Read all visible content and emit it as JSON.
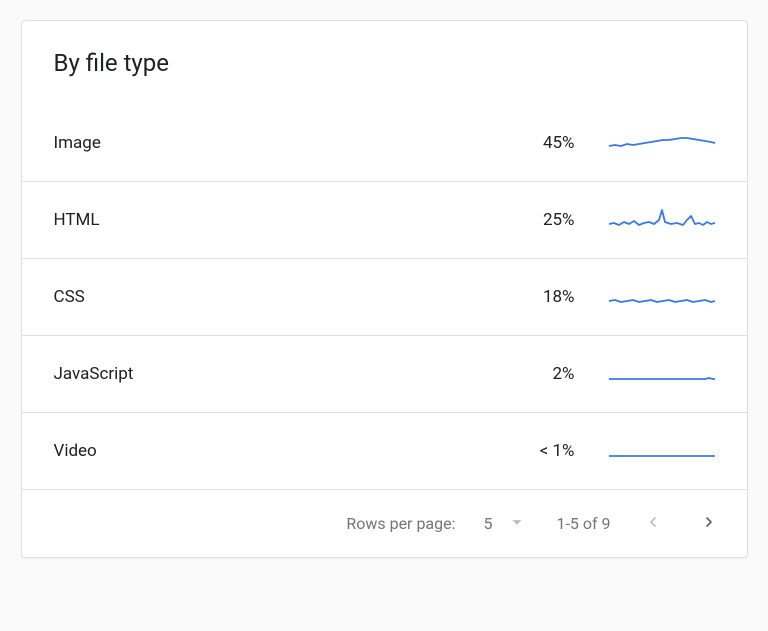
{
  "card": {
    "title": "By file type",
    "rows": [
      {
        "label": "Image",
        "value": "45%"
      },
      {
        "label": "HTML",
        "value": "25%"
      },
      {
        "label": "CSS",
        "value": "18%"
      },
      {
        "label": "JavaScript",
        "value": "2%"
      },
      {
        "label": "Video",
        "value": "< 1%"
      }
    ],
    "spark_color": "#3b78e7"
  },
  "footer": {
    "rows_per_page_label": "Rows per page:",
    "rows_per_page_value": "5",
    "range_text": "1-5 of 9"
  }
}
